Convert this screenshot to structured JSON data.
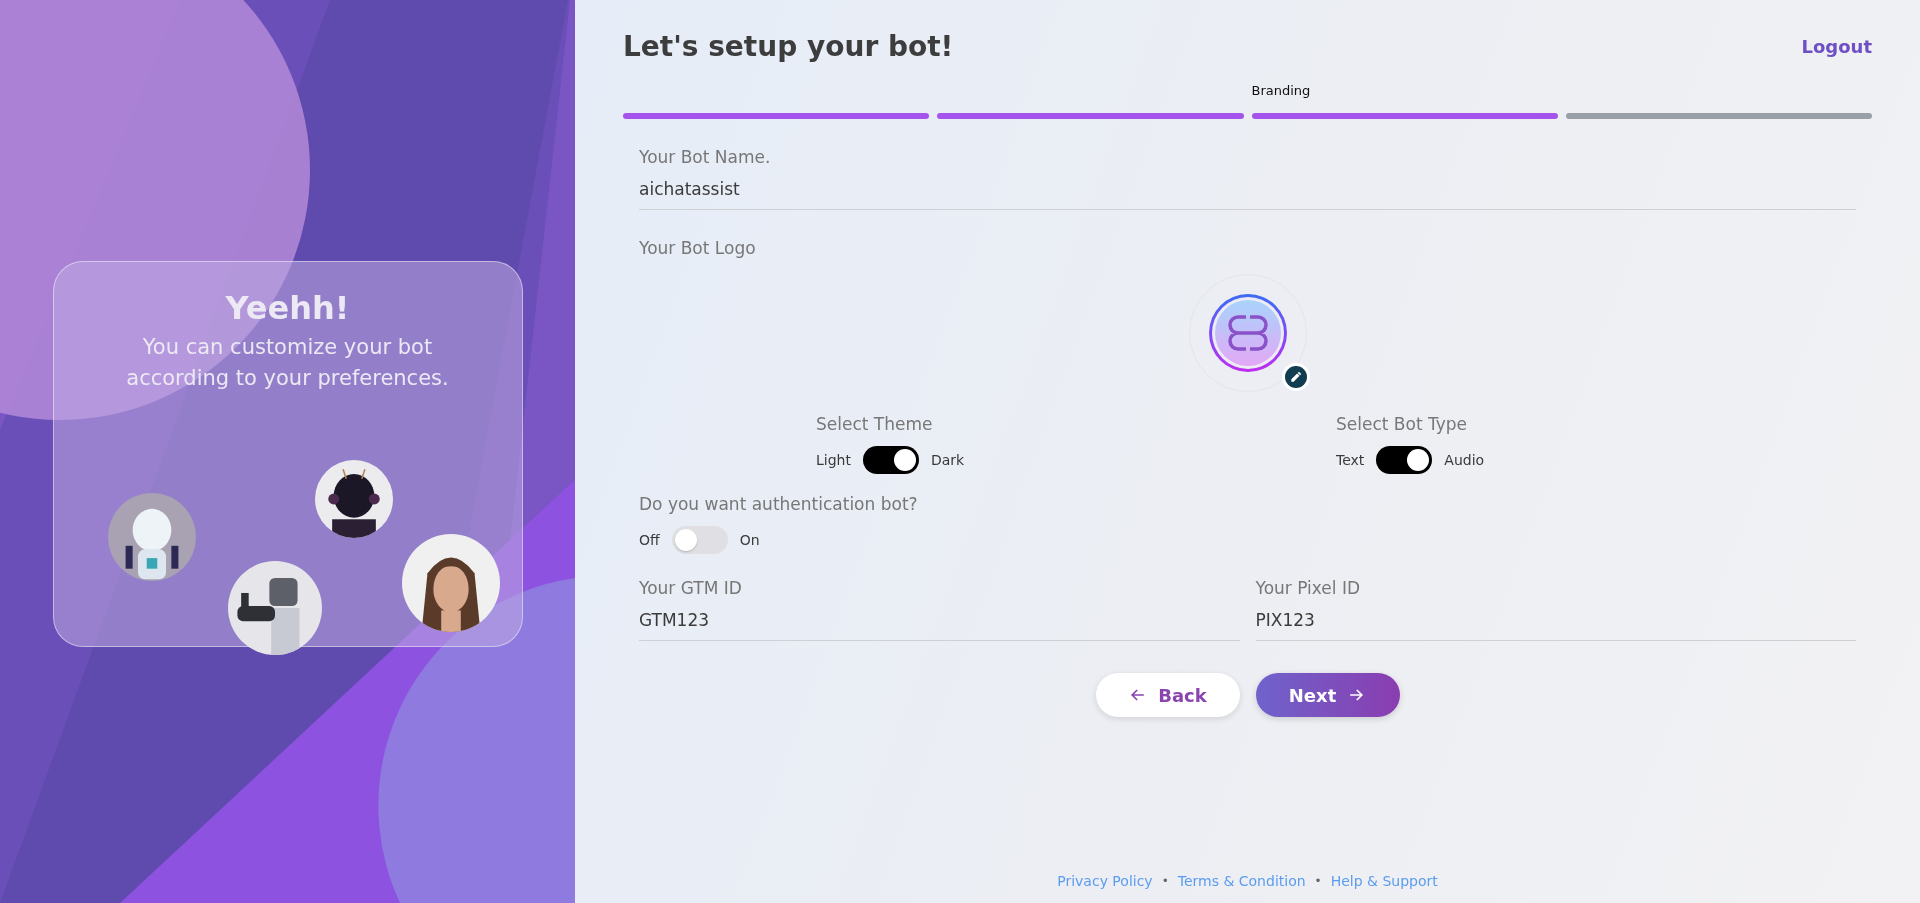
{
  "left_panel": {
    "card": {
      "title": "Yeehh!",
      "message": "You can customize your bot according to your preferences."
    }
  },
  "header": {
    "title": "Let's setup your bot!",
    "logout": "Logout"
  },
  "steps": [
    {
      "completed": true
    },
    {
      "completed": true
    },
    {
      "completed": true,
      "label": "Branding"
    },
    {
      "completed": false
    }
  ],
  "bot_name": {
    "label": "Your Bot Name.",
    "value": "aichatassist"
  },
  "bot_logo": {
    "label": "Your Bot Logo"
  },
  "toggles": [
    {
      "label": "Select Theme",
      "off_label": "Light",
      "on_label": "Dark",
      "on": true
    },
    {
      "label": "Select Bot Type",
      "off_label": "Text",
      "on_label": "Audio",
      "on": true
    }
  ],
  "authentication": {
    "question": "Do you want authentication bot?",
    "off_label": "Off",
    "on_label": "On",
    "on": false
  },
  "ids": [
    {
      "label": "Your GTM ID",
      "value": "GTM123"
    },
    {
      "label": "Your Pixel ID",
      "value": "PIX123"
    }
  ],
  "buttons": {
    "back": "Back",
    "next": "Next"
  },
  "footer": {
    "separator": "•",
    "links": [
      "Privacy Policy",
      "Terms & Condition",
      "Help & Support"
    ]
  }
}
